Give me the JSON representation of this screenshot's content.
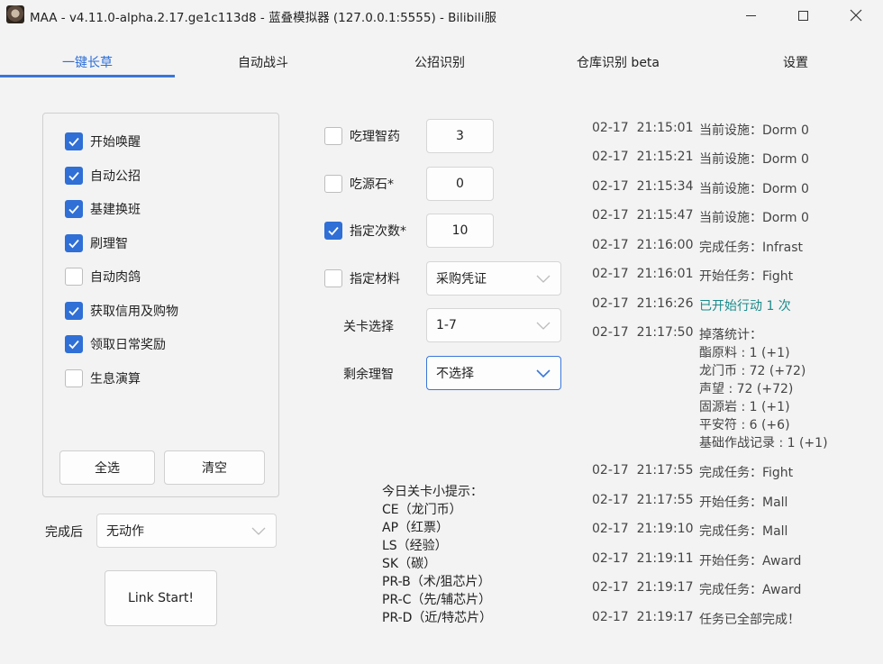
{
  "window": {
    "title": "MAA - v4.11.0-alpha.2.17.ge1c113d8 - 蓝叠模拟器 (127.0.0.1:5555) - Bilibili服"
  },
  "tabs": [
    {
      "label": "一键长草",
      "active": true
    },
    {
      "label": "自动战斗"
    },
    {
      "label": "公招识别"
    },
    {
      "label": "仓库识别 beta"
    },
    {
      "label": "设置"
    }
  ],
  "tasks": [
    {
      "label": "开始唤醒",
      "checked": true
    },
    {
      "label": "自动公招",
      "checked": true
    },
    {
      "label": "基建换班",
      "checked": true
    },
    {
      "label": "刷理智",
      "checked": true
    },
    {
      "label": "自动肉鸽",
      "checked": false
    },
    {
      "label": "获取信用及购物",
      "checked": true
    },
    {
      "label": "领取日常奖励",
      "checked": true
    },
    {
      "label": "生息演算",
      "checked": false
    }
  ],
  "buttons": {
    "select_all": "全选",
    "clear": "清空",
    "link_start": "Link Start!"
  },
  "after_finish": {
    "label": "完成后",
    "value": "无动作"
  },
  "fight": {
    "medicine": {
      "label": "吃理智药",
      "checked": false,
      "value": "3"
    },
    "stone": {
      "label": "吃源石*",
      "checked": false,
      "value": "0"
    },
    "times": {
      "label": "指定次数*",
      "checked": true,
      "value": "10"
    },
    "material": {
      "label": "指定材料",
      "checked": false,
      "value": "采购凭证"
    },
    "stage": {
      "label": "关卡选择",
      "value": "1-7"
    },
    "remaining": {
      "label": "剩余理智",
      "value": "不选择"
    }
  },
  "tips": {
    "title": "今日关卡小提示：",
    "items": [
      "CE（龙门币）",
      "AP（红票）",
      "LS（经验）",
      "SK（碳）",
      "PR-B（术/狙芯片）",
      "PR-C（先/辅芯片）",
      "PR-D（近/特芯片）"
    ]
  },
  "log": [
    {
      "date": "02-17",
      "time": "21:15:01",
      "msg": "当前设施：Dorm 0"
    },
    {
      "date": "02-17",
      "time": "21:15:21",
      "msg": "当前设施：Dorm 0"
    },
    {
      "date": "02-17",
      "time": "21:15:34",
      "msg": "当前设施：Dorm 0"
    },
    {
      "date": "02-17",
      "time": "21:15:47",
      "msg": "当前设施：Dorm 0"
    },
    {
      "date": "02-17",
      "time": "21:16:00",
      "msg": "完成任务：Infrast"
    },
    {
      "date": "02-17",
      "time": "21:16:01",
      "msg": "开始任务：Fight"
    },
    {
      "date": "02-17",
      "time": "21:16:26",
      "msg": "已开始行动 1 次",
      "info": true
    },
    {
      "date": "02-17",
      "time": "21:17:50",
      "msg": "掉落统计：",
      "drops": [
        "酯原料 : 1 (+1)",
        "龙门币 : 72 (+72)",
        "声望 : 72 (+72)",
        "固源岩 : 1 (+1)",
        "平安符 : 6 (+6)",
        "基础作战记录 : 1 (+1)"
      ]
    },
    {
      "date": "02-17",
      "time": "21:17:55",
      "msg": "完成任务：Fight"
    },
    {
      "date": "02-17",
      "time": "21:17:55",
      "msg": "开始任务：Mall"
    },
    {
      "date": "02-17",
      "time": "21:19:10",
      "msg": "完成任务：Mall"
    },
    {
      "date": "02-17",
      "time": "21:19:11",
      "msg": "开始任务：Award"
    },
    {
      "date": "02-17",
      "time": "21:19:17",
      "msg": "完成任务：Award"
    },
    {
      "date": "02-17",
      "time": "21:19:17",
      "msg": "任务已全部完成！"
    }
  ]
}
